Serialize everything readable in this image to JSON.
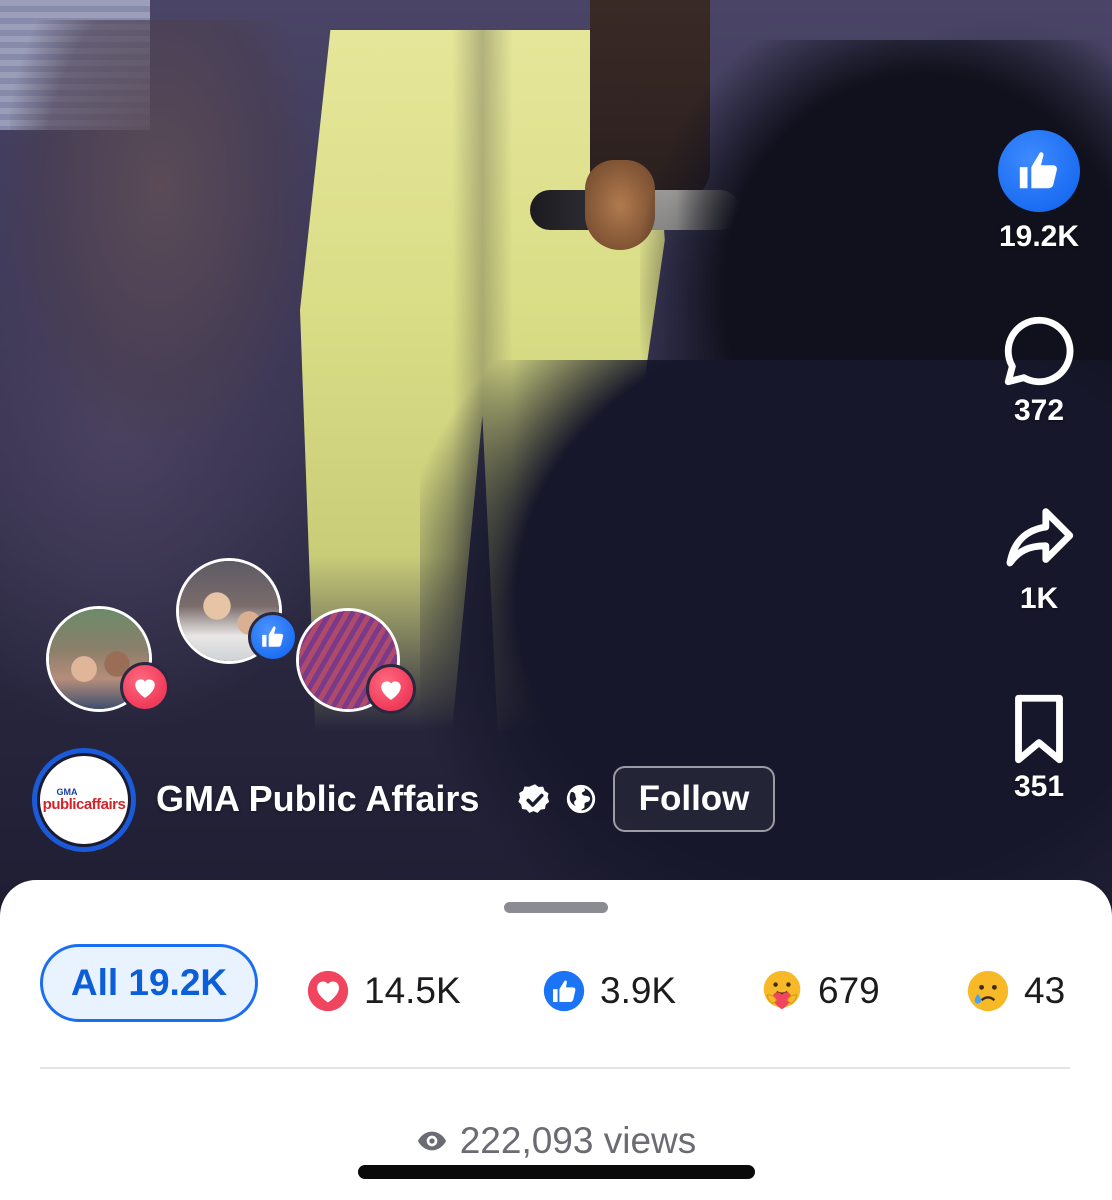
{
  "video": {
    "description_colors": {
      "stage": "#3b3757",
      "pants": "#d9dd86"
    }
  },
  "rail": {
    "like_count": "19.2K",
    "comment_count": "372",
    "share_count": "1K",
    "save_count": "351",
    "accent": "#1b6df2"
  },
  "reactors": [
    {
      "reaction": "heart-icon"
    },
    {
      "reaction": "like-icon"
    },
    {
      "reaction": "heart-icon"
    }
  ],
  "page": {
    "avatar_brand_top": "GMA",
    "avatar_brand": "publicaffairs",
    "name": "GMA Public Affairs",
    "follow_label": "Follow"
  },
  "reactions_sheet": {
    "tabs": [
      {
        "label": "All 19.2K",
        "selected": true
      },
      {
        "icon": "love-icon",
        "label": "14.5K"
      },
      {
        "icon": "like-icon",
        "label": "3.9K"
      },
      {
        "icon": "care-icon",
        "label": "679"
      },
      {
        "icon": "sad-icon",
        "label": "43"
      }
    ],
    "views": "222,093 views"
  }
}
